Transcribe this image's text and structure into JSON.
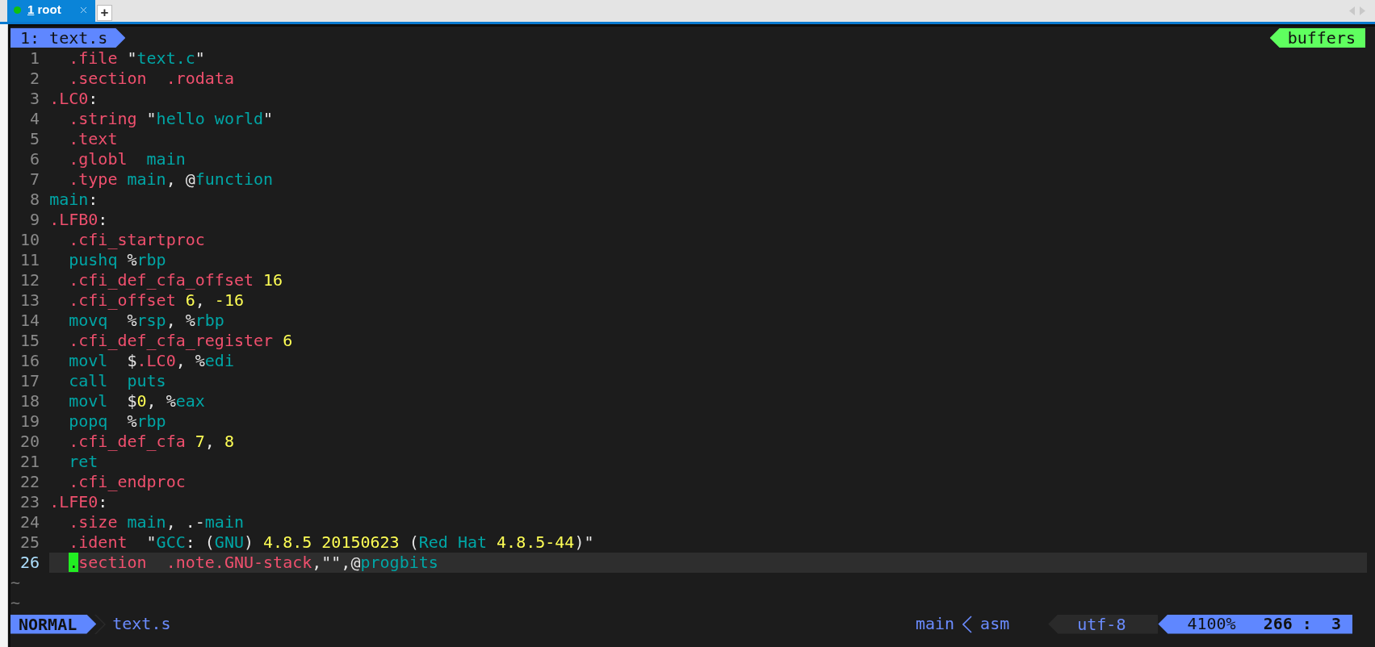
{
  "tab_bar": {
    "tabs": [
      {
        "number": "1",
        "label": "root",
        "selected": true
      }
    ],
    "new_tab": "+"
  },
  "editor": {
    "buffer_label": "1: text.s",
    "buffers_label": "buffers",
    "lines": [
      {
        "number": "1",
        "indent": true,
        "current": false,
        "tokens": [
          {
            "text": ".file",
            "kind": "dir"
          },
          {
            "text": " \"",
            "kind": "plain"
          },
          {
            "text": "text.c",
            "kind": "id"
          },
          {
            "text": "\"",
            "kind": "plain"
          }
        ]
      },
      {
        "number": "2",
        "indent": true,
        "current": false,
        "tokens": [
          {
            "text": ".section  .rodata",
            "kind": "dir"
          }
        ]
      },
      {
        "number": "3",
        "indent": false,
        "current": false,
        "tokens": [
          {
            "text": ".LC0",
            "kind": "dir"
          },
          {
            "text": ":",
            "kind": "plain"
          }
        ]
      },
      {
        "number": "4",
        "indent": true,
        "current": false,
        "tokens": [
          {
            "text": ".string",
            "kind": "dir"
          },
          {
            "text": " \"",
            "kind": "plain"
          },
          {
            "text": "hello world",
            "kind": "id"
          },
          {
            "text": "\"",
            "kind": "plain"
          }
        ]
      },
      {
        "number": "5",
        "indent": true,
        "current": false,
        "tokens": [
          {
            "text": ".text",
            "kind": "dir"
          }
        ]
      },
      {
        "number": "6",
        "indent": true,
        "current": false,
        "tokens": [
          {
            "text": ".globl",
            "kind": "dir"
          },
          {
            "text": "  main",
            "kind": "id"
          }
        ]
      },
      {
        "number": "7",
        "indent": true,
        "current": false,
        "tokens": [
          {
            "text": ".type",
            "kind": "dir"
          },
          {
            "text": " main",
            "kind": "id"
          },
          {
            "text": ", @",
            "kind": "plain"
          },
          {
            "text": "function",
            "kind": "id"
          }
        ]
      },
      {
        "number": "8",
        "indent": false,
        "current": false,
        "tokens": [
          {
            "text": "main",
            "kind": "id"
          },
          {
            "text": ":",
            "kind": "plain"
          }
        ]
      },
      {
        "number": "9",
        "indent": false,
        "current": false,
        "tokens": [
          {
            "text": ".LFB0",
            "kind": "dir"
          },
          {
            "text": ":",
            "kind": "plain"
          }
        ]
      },
      {
        "number": "10",
        "indent": true,
        "current": false,
        "tokens": [
          {
            "text": ".cfi_startproc",
            "kind": "dir"
          }
        ]
      },
      {
        "number": "11",
        "indent": true,
        "current": false,
        "tokens": [
          {
            "text": "pushq",
            "kind": "id"
          },
          {
            "text": " %",
            "kind": "plain"
          },
          {
            "text": "rbp",
            "kind": "id"
          }
        ]
      },
      {
        "number": "12",
        "indent": true,
        "current": false,
        "tokens": [
          {
            "text": ".cfi_def_cfa_offset",
            "kind": "dir"
          },
          {
            "text": " 16",
            "kind": "num"
          }
        ]
      },
      {
        "number": "13",
        "indent": true,
        "current": false,
        "tokens": [
          {
            "text": ".cfi_offset",
            "kind": "dir"
          },
          {
            "text": " 6",
            "kind": "num"
          },
          {
            "text": ", ",
            "kind": "plain"
          },
          {
            "text": "-16",
            "kind": "num"
          }
        ]
      },
      {
        "number": "14",
        "indent": true,
        "current": false,
        "tokens": [
          {
            "text": "movq",
            "kind": "id"
          },
          {
            "text": "  %",
            "kind": "plain"
          },
          {
            "text": "rsp",
            "kind": "id"
          },
          {
            "text": ", %",
            "kind": "plain"
          },
          {
            "text": "rbp",
            "kind": "id"
          }
        ]
      },
      {
        "number": "15",
        "indent": true,
        "current": false,
        "tokens": [
          {
            "text": ".cfi_def_cfa_register",
            "kind": "dir"
          },
          {
            "text": " 6",
            "kind": "num"
          }
        ]
      },
      {
        "number": "16",
        "indent": true,
        "current": false,
        "tokens": [
          {
            "text": "movl",
            "kind": "id"
          },
          {
            "text": "  $",
            "kind": "plain"
          },
          {
            "text": ".LC0",
            "kind": "dir"
          },
          {
            "text": ", %",
            "kind": "plain"
          },
          {
            "text": "edi",
            "kind": "id"
          }
        ]
      },
      {
        "number": "17",
        "indent": true,
        "current": false,
        "tokens": [
          {
            "text": "call  puts",
            "kind": "id"
          }
        ]
      },
      {
        "number": "18",
        "indent": true,
        "current": false,
        "tokens": [
          {
            "text": "movl",
            "kind": "id"
          },
          {
            "text": "  $",
            "kind": "plain"
          },
          {
            "text": "0",
            "kind": "num"
          },
          {
            "text": ", %",
            "kind": "plain"
          },
          {
            "text": "eax",
            "kind": "id"
          }
        ]
      },
      {
        "number": "19",
        "indent": true,
        "current": false,
        "tokens": [
          {
            "text": "popq",
            "kind": "id"
          },
          {
            "text": "  %",
            "kind": "plain"
          },
          {
            "text": "rbp",
            "kind": "id"
          }
        ]
      },
      {
        "number": "20",
        "indent": true,
        "current": false,
        "tokens": [
          {
            "text": ".cfi_def_cfa",
            "kind": "dir"
          },
          {
            "text": " 7",
            "kind": "num"
          },
          {
            "text": ", ",
            "kind": "plain"
          },
          {
            "text": "8",
            "kind": "num"
          }
        ]
      },
      {
        "number": "21",
        "indent": true,
        "current": false,
        "tokens": [
          {
            "text": "ret",
            "kind": "id"
          }
        ]
      },
      {
        "number": "22",
        "indent": true,
        "current": false,
        "tokens": [
          {
            "text": ".cfi_endproc",
            "kind": "dir"
          }
        ]
      },
      {
        "number": "23",
        "indent": false,
        "current": false,
        "tokens": [
          {
            "text": ".LFE0",
            "kind": "dir"
          },
          {
            "text": ":",
            "kind": "plain"
          }
        ]
      },
      {
        "number": "24",
        "indent": true,
        "current": false,
        "tokens": [
          {
            "text": ".size",
            "kind": "dir"
          },
          {
            "text": " main",
            "kind": "id"
          },
          {
            "text": ", .-",
            "kind": "plain"
          },
          {
            "text": "main",
            "kind": "id"
          }
        ]
      },
      {
        "number": "25",
        "indent": true,
        "current": false,
        "tokens": [
          {
            "text": ".ident",
            "kind": "dir"
          },
          {
            "text": "  \"",
            "kind": "plain"
          },
          {
            "text": "GCC",
            "kind": "id"
          },
          {
            "text": ": (",
            "kind": "plain"
          },
          {
            "text": "GNU",
            "kind": "id"
          },
          {
            "text": ") ",
            "kind": "plain"
          },
          {
            "text": "4.8.5 20150623",
            "kind": "num"
          },
          {
            "text": " (",
            "kind": "plain"
          },
          {
            "text": "Red Hat ",
            "kind": "id"
          },
          {
            "text": "4.8.5-44",
            "kind": "num"
          },
          {
            "text": ")\"",
            "kind": "plain"
          }
        ]
      },
      {
        "number": "26",
        "indent": true,
        "current": true,
        "tokens": [
          {
            "text": ".",
            "kind": "cursor"
          },
          {
            "text": "section  .note.GNU-stack",
            "kind": "dir"
          },
          {
            "text": ",\"\",@",
            "kind": "plain"
          },
          {
            "text": "progbits",
            "kind": "id"
          }
        ]
      }
    ],
    "empty_line_markers": [
      "~",
      "~"
    ]
  },
  "status_line": {
    "mode": "NORMAL",
    "file": "text.s",
    "function": "main",
    "filetype": "asm",
    "encoding": "utf-8",
    "percent": "4100%",
    "position": "266 :  3"
  }
}
